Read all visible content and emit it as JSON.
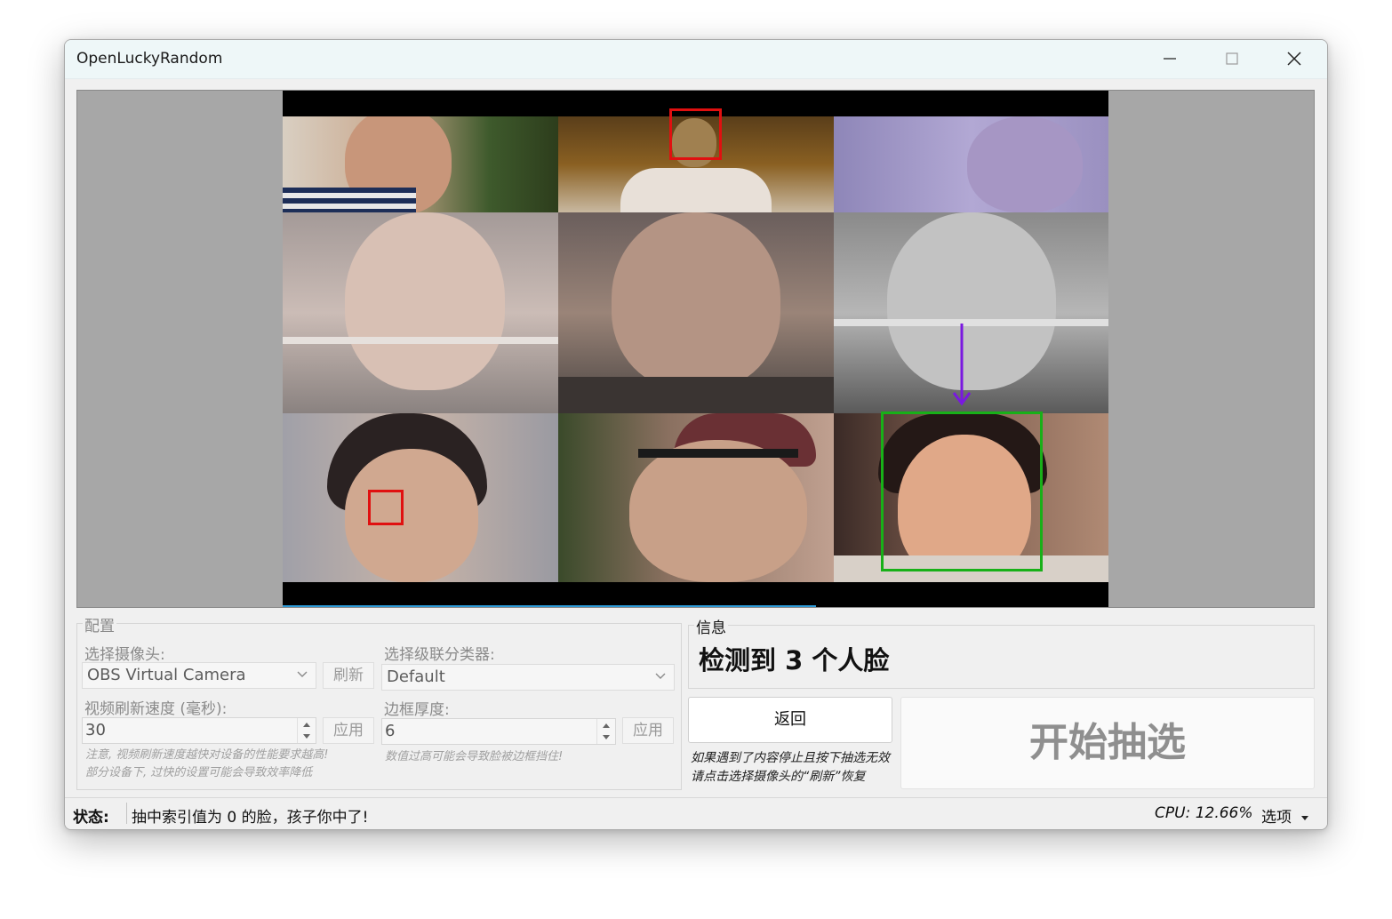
{
  "window": {
    "title": "OpenLuckyRandom"
  },
  "preview": {
    "faces_detected": 3,
    "selected_index": 0
  },
  "config": {
    "title": "配置",
    "camera_label": "选择摄像头:",
    "camera_value": "OBS Virtual Camera",
    "refresh_button": "刷新",
    "classifier_label": "选择级联分类器:",
    "classifier_value": "Default",
    "speed_label": "视频刷新速度 (毫秒):",
    "speed_value": "30",
    "apply_button": "应用",
    "border_label": "边框厚度:",
    "border_value": "6",
    "speed_hint_1": "注意, 视频刷新速度越快对设备的性能要求越高!",
    "speed_hint_2": "部分设备下, 过快的设置可能会导致效率降低",
    "border_hint": "数值过高可能会导致脸被边框挡住!"
  },
  "info": {
    "title": "信息",
    "message": "检测到 3 个人脸"
  },
  "actions": {
    "return_button": "返回",
    "note_1": "如果遇到了内容停止且按下抽选无效",
    "note_2": "请点击选择摄像头的“刷新”恢复",
    "start_button": "开始抽选"
  },
  "status": {
    "label": "状态:",
    "message": "抽中索引值为 0 的脸，孩子你中了!",
    "cpu": "CPU: 12.66%",
    "options": "选项"
  }
}
